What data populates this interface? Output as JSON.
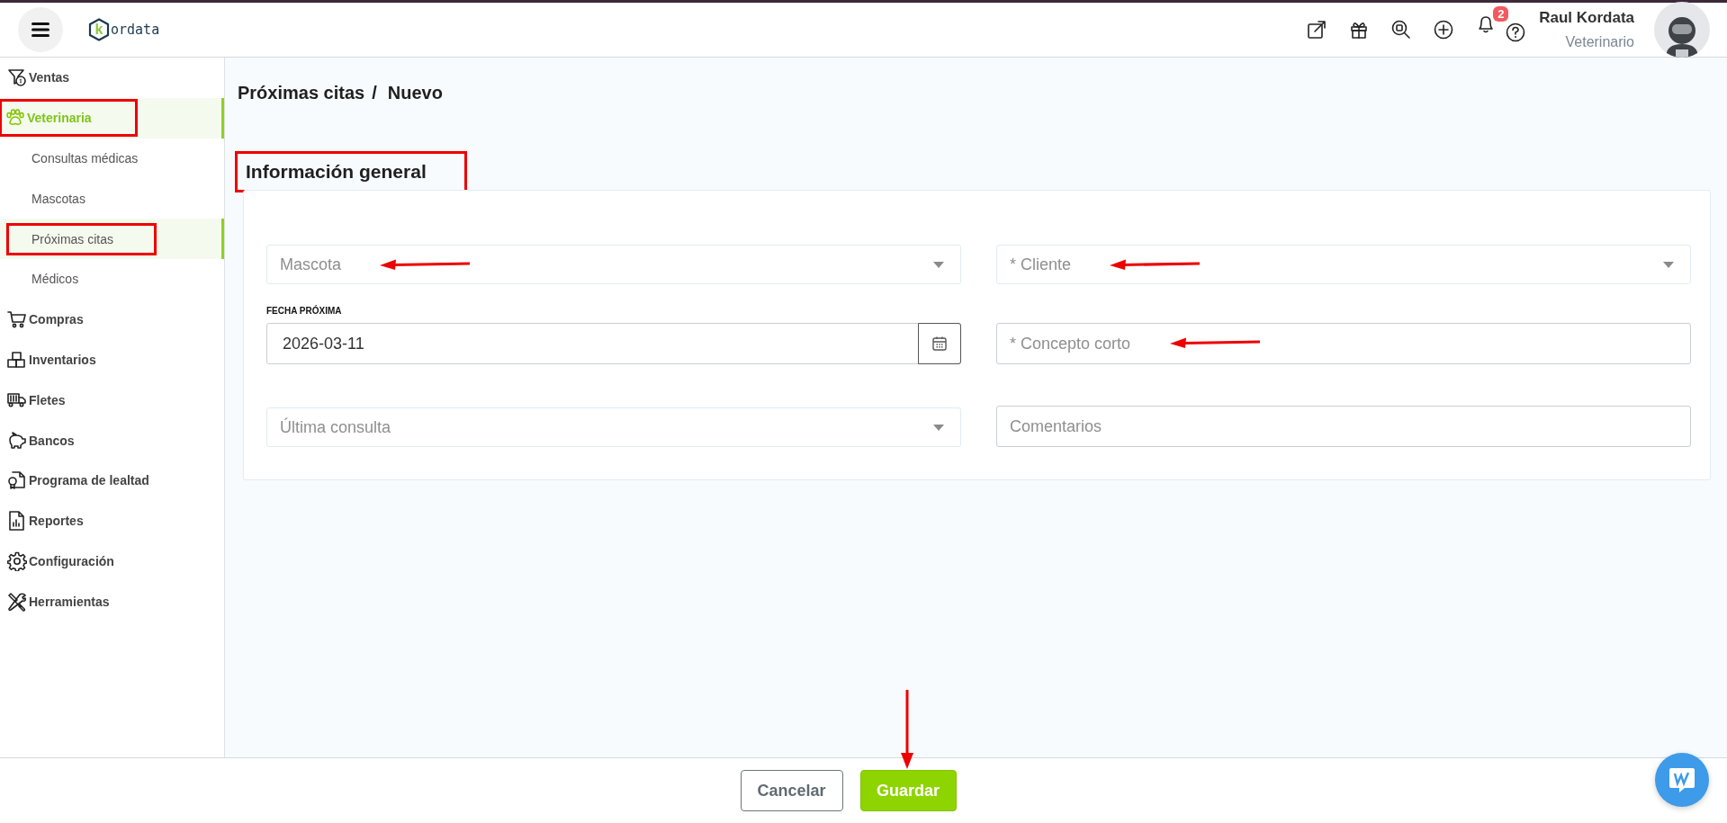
{
  "header": {
    "logo": {
      "mark": "k",
      "text": "ordata"
    },
    "notifications": "2",
    "user": {
      "name": "Raul Kordata",
      "role": "Veterinario"
    }
  },
  "sidebar": {
    "items": [
      {
        "label": "Ventas",
        "selected": false,
        "annotated": false
      },
      {
        "label": "Veterinaria",
        "selected": true,
        "annotated": true,
        "children": [
          {
            "label": "Consultas médicas",
            "selected": false,
            "annotated": false
          },
          {
            "label": "Mascotas",
            "selected": false,
            "annotated": false
          },
          {
            "label": "Próximas citas",
            "selected": true,
            "annotated": true
          },
          {
            "label": "Médicos",
            "selected": false,
            "annotated": false
          }
        ]
      },
      {
        "label": "Compras",
        "selected": false,
        "annotated": false
      },
      {
        "label": "Inventarios",
        "selected": false,
        "annotated": false
      },
      {
        "label": "Fletes",
        "selected": false,
        "annotated": false
      },
      {
        "label": "Bancos",
        "selected": false,
        "annotated": false
      },
      {
        "label": "Programa de lealtad",
        "selected": false,
        "annotated": false
      },
      {
        "label": "Reportes",
        "selected": false,
        "annotated": false
      },
      {
        "label": "Configuración",
        "selected": false,
        "annotated": false
      },
      {
        "label": "Herramientas",
        "selected": false,
        "annotated": false
      }
    ]
  },
  "breadcrumb": [
    "Próximas citas",
    "/",
    "Nuevo"
  ],
  "section": {
    "title": "Información general",
    "annotated": true,
    "fields": [
      {
        "kind": "select",
        "placeholder": "Mascota",
        "annotated": true
      },
      {
        "kind": "select",
        "placeholder": "* Cliente",
        "annotated": true
      },
      {
        "kind": "date",
        "label": "FECHA PRÓXIMA",
        "value": "2026-03-11",
        "annotated": false
      },
      {
        "kind": "text",
        "placeholder": "* Concepto corto",
        "annotated": true
      },
      {
        "kind": "select",
        "placeholder": "Última consulta",
        "annotated": false
      },
      {
        "kind": "text",
        "placeholder": "Comentarios",
        "annotated": false
      }
    ]
  },
  "footer": {
    "buttons": [
      {
        "label": "Cancelar",
        "kind": "secondary",
        "annotated": false
      },
      {
        "label": "Guardar",
        "kind": "primary",
        "annotated": true
      }
    ]
  }
}
